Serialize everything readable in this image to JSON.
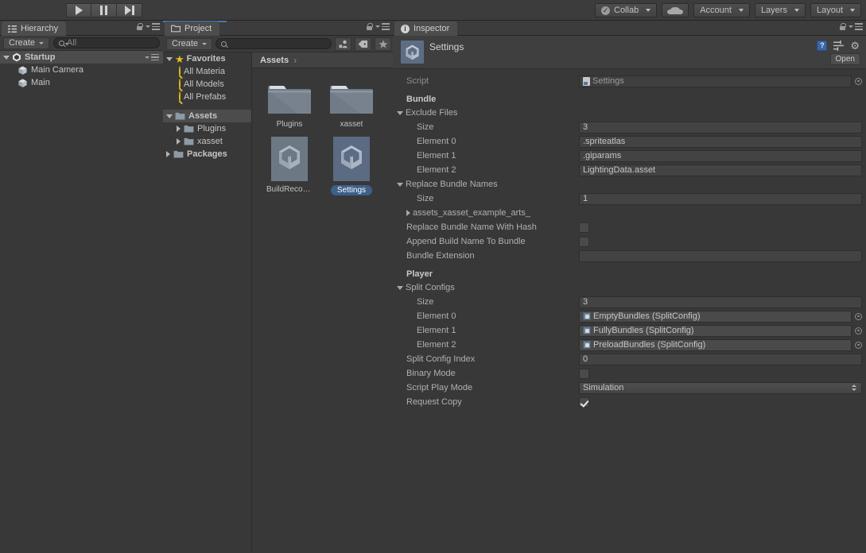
{
  "toolbar": {
    "play_label": "play-icon",
    "pause_label": "pause-icon",
    "step_label": "step-icon",
    "collab": "Collab",
    "cloud": "cloud-icon",
    "account": "Account",
    "layers": "Layers",
    "layout": "Layout"
  },
  "hierarchy": {
    "tab": "Hierarchy",
    "create": "Create",
    "search_value": "All",
    "search_placeholder": "All",
    "scene": "Startup",
    "items": [
      {
        "label": "Main Camera",
        "icon": "cube-icon"
      },
      {
        "label": "Main",
        "icon": "cube-icon"
      }
    ]
  },
  "project": {
    "tab": "Project",
    "create": "Create",
    "search_value": "",
    "search_placeholder": "",
    "icons": [
      "filter-by-type-icon",
      "label-icon",
      "favorite-star-icon"
    ],
    "favorites_label": "Favorites",
    "favorites": [
      "All Materia",
      "All Models",
      "All Prefabs"
    ],
    "assets_label": "Assets",
    "assets_children": [
      "Plugins",
      "xasset"
    ],
    "packages_label": "Packages",
    "breadcrumb": "Assets",
    "breadcrumb_sep": "›",
    "grid": [
      {
        "label": "Plugins",
        "kind": "folder",
        "selected": false
      },
      {
        "label": "xasset",
        "kind": "folder",
        "selected": false
      },
      {
        "label": "BuildRecor…",
        "kind": "asset",
        "selected": false
      },
      {
        "label": "Settings",
        "kind": "asset",
        "selected": true
      }
    ]
  },
  "inspector": {
    "tab": "Inspector",
    "title": "Settings",
    "open_button": "Open",
    "help_icon": "?",
    "gear_icon": "⚙",
    "preset_icon": "preset-icon",
    "script_row": {
      "label": "Script",
      "value": "Settings"
    },
    "sections": [
      {
        "name": "Bundle",
        "rows": [
          {
            "type": "foldout",
            "label": "Exclude Files",
            "open": true
          },
          {
            "type": "text",
            "label": "Size",
            "value": "3",
            "indent": 2
          },
          {
            "type": "text",
            "label": "Element 0",
            "value": ".spriteatlas",
            "indent": 2
          },
          {
            "type": "text",
            "label": "Element 1",
            "value": ".giparams",
            "indent": 2
          },
          {
            "type": "text",
            "label": "Element 2",
            "value": "LightingData.asset",
            "indent": 2
          },
          {
            "type": "foldout",
            "label": "Replace Bundle Names",
            "open": true
          },
          {
            "type": "text",
            "label": "Size",
            "value": "1",
            "indent": 2
          },
          {
            "type": "foldout-child",
            "label": "assets_xasset_example_arts_",
            "open": false
          },
          {
            "type": "checkbox",
            "label": "Replace Bundle Name With Hash",
            "checked": false
          },
          {
            "type": "checkbox",
            "label": "Append Build Name To Bundle",
            "checked": false
          },
          {
            "type": "text",
            "label": "Bundle Extension",
            "value": ""
          }
        ]
      },
      {
        "name": "Player",
        "rows": [
          {
            "type": "foldout",
            "label": "Split Configs",
            "open": true
          },
          {
            "type": "text",
            "label": "Size",
            "value": "3",
            "indent": 2
          },
          {
            "type": "objref",
            "label": "Element 0",
            "value": "EmptyBundles (SplitConfig)",
            "indent": 2
          },
          {
            "type": "objref",
            "label": "Element 1",
            "value": "FullyBundles (SplitConfig)",
            "indent": 2
          },
          {
            "type": "objref",
            "label": "Element 2",
            "value": "PreloadBundles (SplitConfig)",
            "indent": 2
          },
          {
            "type": "text",
            "label": "Split Config Index",
            "value": "0"
          },
          {
            "type": "checkbox",
            "label": "Binary Mode",
            "checked": false
          },
          {
            "type": "popup",
            "label": "Script Play Mode",
            "value": "Simulation"
          },
          {
            "type": "checkbox",
            "label": "Request Copy",
            "checked": true
          }
        ]
      }
    ]
  },
  "colors": {
    "panel_bg": "#383838",
    "toolbar_bg": "#3c3c3c",
    "selection_blue": "#3d5f8a",
    "tab_accent": "#4a77b8",
    "star_yellow": "#e8c01e",
    "text": "#b4b4b4"
  }
}
